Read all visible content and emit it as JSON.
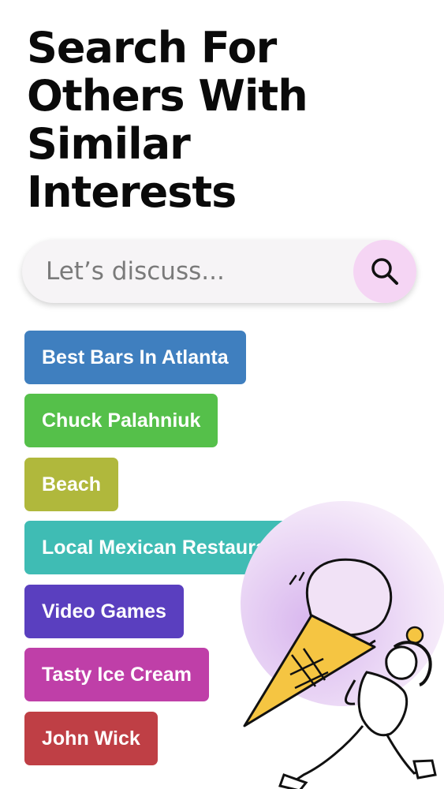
{
  "headline": {
    "lines": [
      "Search For",
      "Others With",
      "Similar",
      "Interests"
    ]
  },
  "search": {
    "placeholder": "Let’s discuss...",
    "button_icon": "search-icon"
  },
  "topics": [
    {
      "label": "Best Bars In Atlanta",
      "color": "#3f7fbf"
    },
    {
      "label": "Chuck Palahniuk",
      "color": "#55c04a"
    },
    {
      "label": "Beach",
      "color": "#b0b83c"
    },
    {
      "label": "Local Mexican Restaurants",
      "color": "#3fbcb4"
    },
    {
      "label": "Video Games",
      "color": "#5a3fbf"
    },
    {
      "label": "Tasty Ice Cream",
      "color": "#bf3fa8"
    },
    {
      "label": "John Wick",
      "color": "#bf3f45"
    }
  ],
  "colors": {
    "search_button_bg": "#f5d5f4",
    "illustration_circle": "#ead2f3",
    "ice_cream": "#ecd9f2",
    "cone": "#f5c542"
  }
}
